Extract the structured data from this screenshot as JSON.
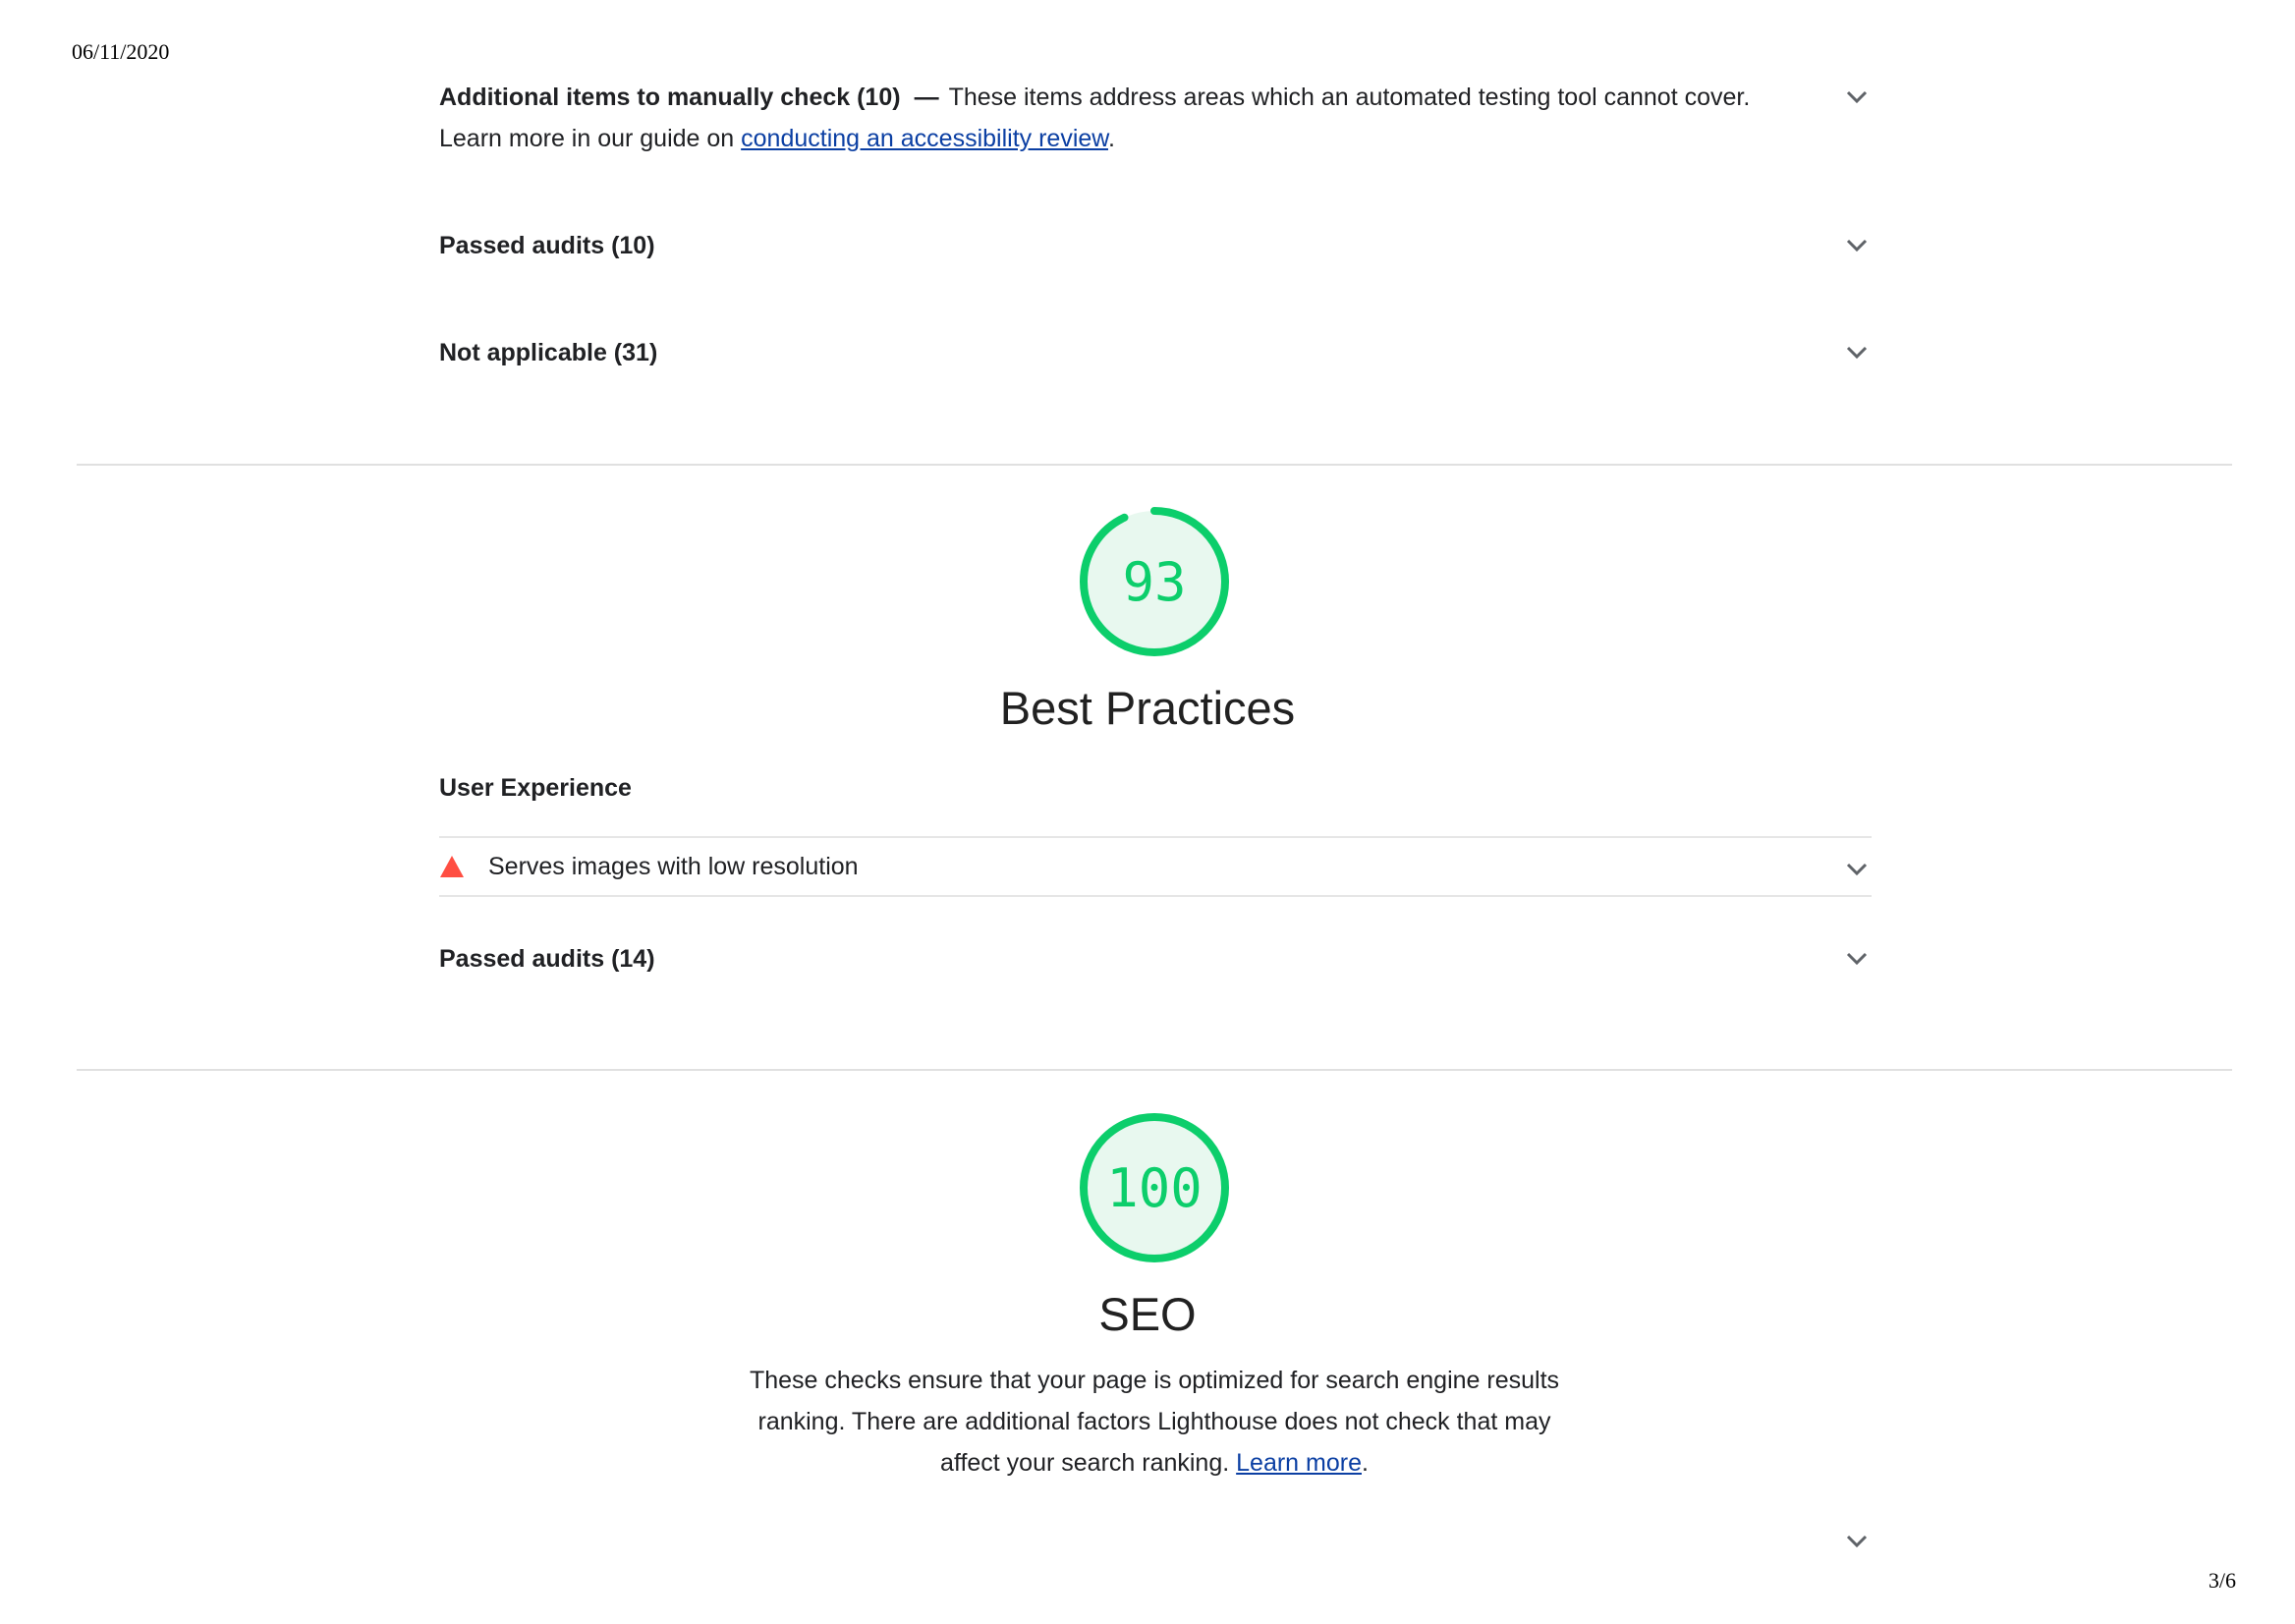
{
  "print_header": {
    "date": "06/11/2020"
  },
  "accessibility_groups": {
    "manual": {
      "title": "Additional items to manually check (10)",
      "separator": "—",
      "description": "These items address areas which an automated testing tool cannot cover.",
      "learn_prefix": "Learn more in our guide on",
      "link_text": "conducting an accessibility review",
      "suffix": "."
    },
    "passed": {
      "title": "Passed audits (10)"
    },
    "not_applicable": {
      "title": "Not applicable (31)"
    }
  },
  "best_practices": {
    "score": "93",
    "score_value": 93,
    "title": "Best Practices",
    "group_title": "User Experience",
    "failed_audit": "Serves images with low resolution",
    "passed": "Passed audits (14)"
  },
  "seo": {
    "score": "100",
    "score_value": 100,
    "title": "SEO",
    "desc_line1": "These checks ensure that your page is optimized for search engine results",
    "desc_line2": "ranking. There are additional factors Lighthouse does not check that may",
    "desc_line3_prefix": "affect your search ranking.",
    "learn_more": "Learn more",
    "suffix": "."
  },
  "footer": {
    "page": "3/6"
  },
  "colors": {
    "pass_green": "#0cce6b",
    "pass_bg": "#e8f8ef",
    "fail_red": "#ff4e42",
    "link_blue": "#0b3fa3"
  },
  "icons": {
    "expand": "chevron-down-icon",
    "fail": "fail-triangle-icon"
  }
}
